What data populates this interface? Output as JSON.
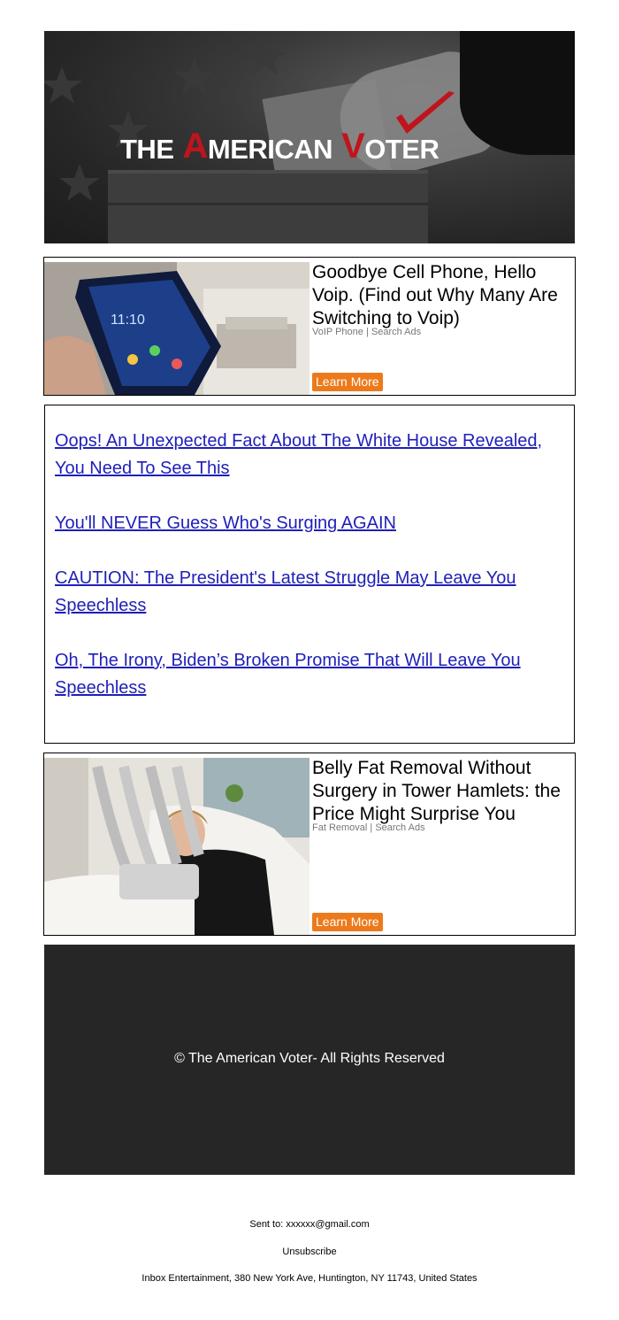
{
  "header": {
    "logo": {
      "the": "THE",
      "a": "A",
      "merican": "MERICAN",
      "v": "V",
      "oter": "OTER"
    }
  },
  "ads": [
    {
      "title": "Goodbye Cell Phone, Hello Voip. (Find out Why Many Are Switching to Voip)",
      "source": "VoIP Phone | Search Ads",
      "cta": "Learn More"
    },
    {
      "title": "Belly Fat Removal Without Surgery in Tower Hamlets: the Price Might Surprise You",
      "source": "Fat Removal | Search Ads",
      "cta": "Learn More"
    }
  ],
  "links": [
    "Oops! An Unexpected Fact About The White House Revealed, You Need To See This",
    "You'll NEVER Guess Who's Surging AGAIN",
    "CAUTION: The President's Latest Struggle May Leave You Speechless",
    "Oh, The Irony, Biden’s Broken Promise That Will Leave You Speechless"
  ],
  "footer": {
    "copyright": "© The American Voter- All Rights Reserved",
    "sent_to": "Sent to: xxxxxx@gmail.com",
    "unsubscribe": "Unsubscribe",
    "address": "Inbox Entertainment, 380 New York Ave, Huntington, NY 11743, United States"
  },
  "colors": {
    "accent": "#c0141d",
    "button": "#ec7a1c",
    "link": "#1f1fb8",
    "footer_bg": "#262626"
  }
}
